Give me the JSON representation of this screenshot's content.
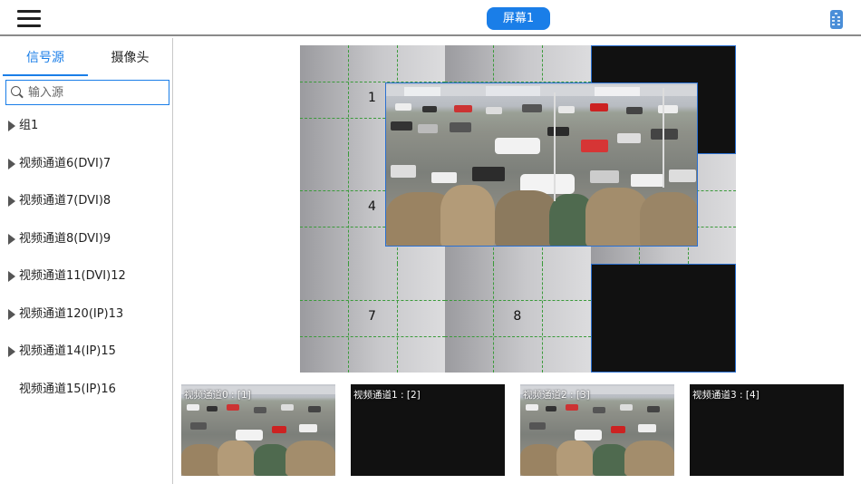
{
  "topbar": {
    "screen_button": "屏幕1",
    "menu_icon": "hamburger-menu-icon",
    "remote_icon": "remote-control-icon"
  },
  "left_panel": {
    "tabs": [
      {
        "label": "信号源",
        "active": true
      },
      {
        "label": "摄像头",
        "active": false
      }
    ],
    "search": {
      "placeholder": "输入源",
      "value": ""
    },
    "tree": [
      {
        "label": "组1",
        "expandable": true
      },
      {
        "label": "视频通道6(DVI)7",
        "expandable": true
      },
      {
        "label": "视频通道7(DVI)8",
        "expandable": true
      },
      {
        "label": "视频通道8(DVI)9",
        "expandable": true
      },
      {
        "label": "视频通道11(DVI)12",
        "expandable": true
      },
      {
        "label": "视频通道120(IP)13",
        "expandable": true
      },
      {
        "label": "视频通道14(IP)15",
        "expandable": true
      },
      {
        "label": "视频通道15(IP)16",
        "expandable": false
      }
    ]
  },
  "wall": {
    "cells": [
      {
        "number": "1",
        "state": "grey"
      },
      {
        "number": "",
        "state": "grey"
      },
      {
        "number": "",
        "state": "black"
      },
      {
        "number": "4",
        "state": "grey"
      },
      {
        "number": "",
        "state": "grey"
      },
      {
        "number": "",
        "state": "grey"
      },
      {
        "number": "7",
        "state": "grey"
      },
      {
        "number": "8",
        "state": "grey"
      },
      {
        "number": "",
        "state": "black"
      }
    ]
  },
  "thumbnails": [
    {
      "label": "视频通道0 : [1]",
      "has_video": true
    },
    {
      "label": "视频通道1 : [2]",
      "has_video": false
    },
    {
      "label": "视频通道2 : [3]",
      "has_video": true
    },
    {
      "label": "视频通道3 : [4]",
      "has_video": false
    }
  ],
  "colors": {
    "accent": "#1a7ee8",
    "window_border": "#2a6fd0",
    "grid_line": "#3a9a3a"
  }
}
